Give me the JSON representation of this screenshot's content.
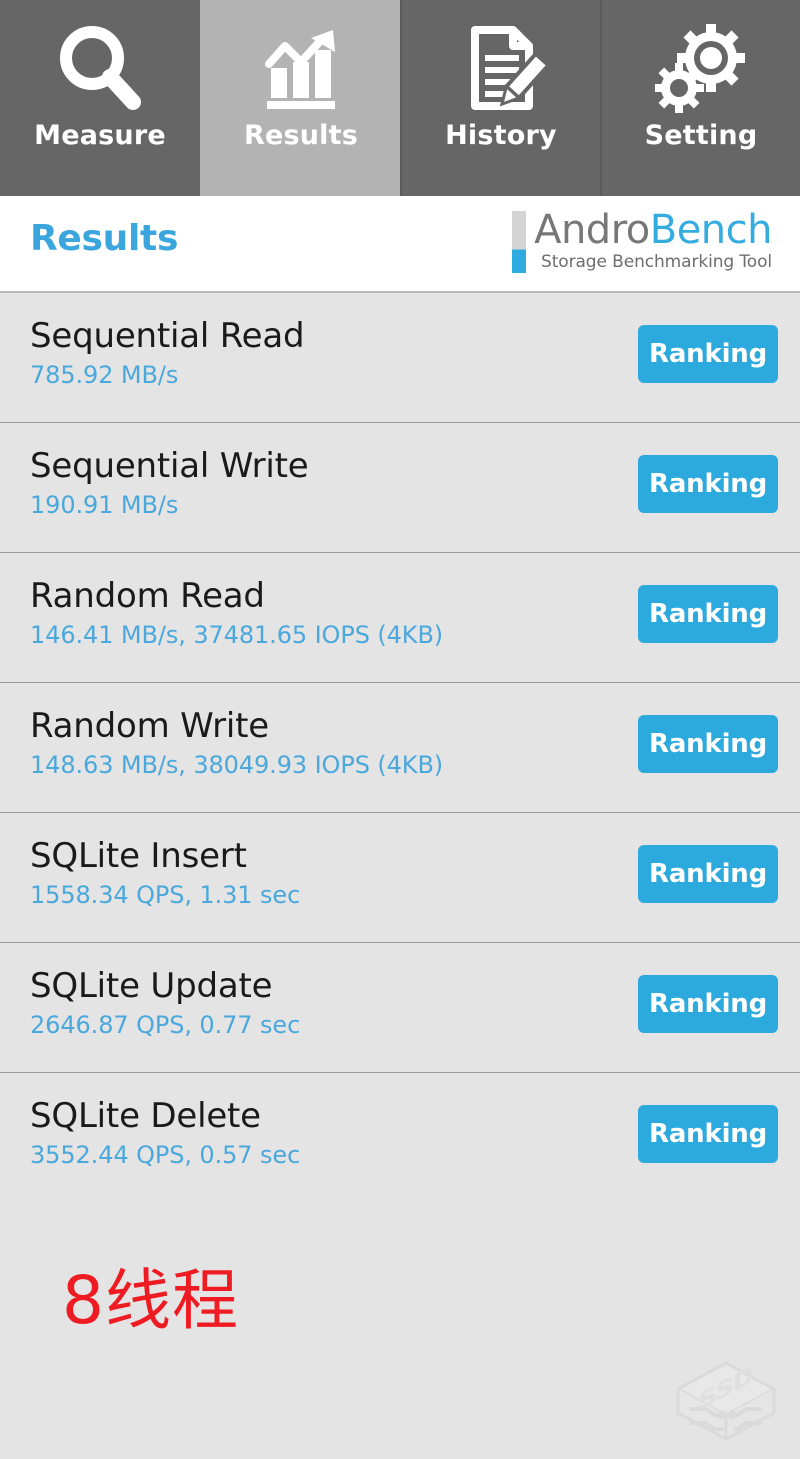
{
  "app": {
    "name": "AndroBench",
    "accent_blue": "#2caade",
    "value_blue": "#4aa8dc",
    "title_blue": "#3aa6dd",
    "tab_inactive_bg": "#666666",
    "tab_active_bg": "#b3b3b3",
    "list_bg": "#e4e4e4",
    "annotation_red": "#ee1c22"
  },
  "tabs": [
    {
      "label": "Measure",
      "icon": "magnifier-icon",
      "active": false
    },
    {
      "label": "Results",
      "icon": "bar-chart-arrow-icon",
      "active": true
    },
    {
      "label": "History",
      "icon": "document-pencil-icon",
      "active": false
    },
    {
      "label": "Setting",
      "icon": "gears-icon",
      "active": false
    }
  ],
  "header": {
    "title": "Results",
    "logo_primary": "Andro",
    "logo_secondary": "Bench",
    "logo_subtitle": "Storage Benchmarking Tool"
  },
  "results": [
    {
      "name": "Sequential Read",
      "value": "785.92 MB/s",
      "button": "Ranking"
    },
    {
      "name": "Sequential Write",
      "value": "190.91 MB/s",
      "button": "Ranking"
    },
    {
      "name": "Random Read",
      "value": "146.41 MB/s, 37481.65 IOPS (4KB)",
      "button": "Ranking"
    },
    {
      "name": "Random Write",
      "value": "148.63 MB/s, 38049.93 IOPS (4KB)",
      "button": "Ranking"
    },
    {
      "name": "SQLite Insert",
      "value": "1558.34 QPS, 1.31 sec",
      "button": "Ranking"
    },
    {
      "name": "SQLite Update",
      "value": "2646.87 QPS, 0.77 sec",
      "button": "Ranking"
    },
    {
      "name": "SQLite Delete",
      "value": "3552.44 QPS, 0.57 sec",
      "button": "Ranking"
    }
  ],
  "annotation": {
    "text": "8线程"
  },
  "watermark": {
    "label": "SSD"
  }
}
